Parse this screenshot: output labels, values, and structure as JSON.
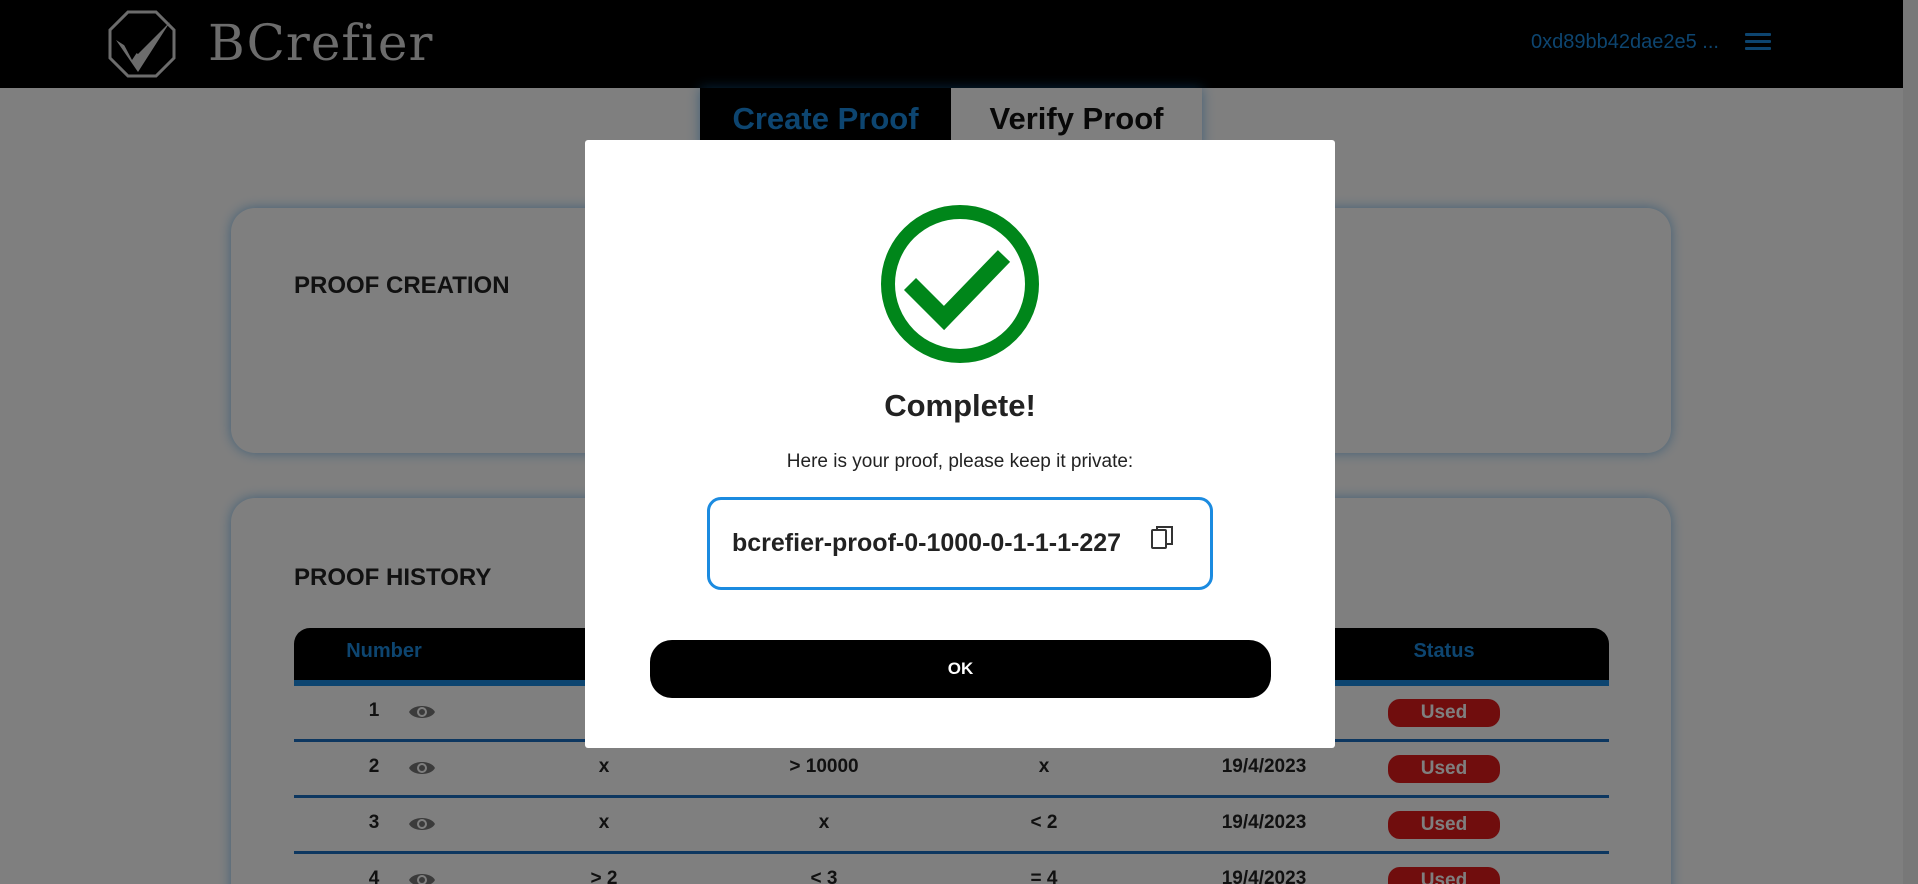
{
  "header": {
    "brand": "BCrefier",
    "wallet_address": "0xd89bb42dae2e5 ..."
  },
  "tabs": [
    {
      "label": "Create Proof",
      "active": true
    },
    {
      "label": "Verify Proof",
      "active": false
    }
  ],
  "creation": {
    "title": "PROOF CREATION"
  },
  "history": {
    "title": "PROOF HISTORY",
    "columns": [
      "Number",
      "",
      "",
      "",
      "",
      "Status"
    ],
    "rows": [
      {
        "number": "1",
        "c1": "",
        "c2": "",
        "c3": "",
        "date": "",
        "status": "Used"
      },
      {
        "number": "2",
        "c1": "x",
        "c2": "> 10000",
        "c3": "x",
        "date": "19/4/2023",
        "status": "Used"
      },
      {
        "number": "3",
        "c1": "x",
        "c2": "x",
        "c3": "< 2",
        "date": "19/4/2023",
        "status": "Used"
      },
      {
        "number": "4",
        "c1": "> 2",
        "c2": "< 3",
        "c3": "= 4",
        "date": "19/4/2023",
        "status": "Used"
      }
    ]
  },
  "modal": {
    "title": "Complete!",
    "message": "Here is your proof, please keep it private:",
    "proof": "bcrefier-proof-0-1000-0-1-1-1-227",
    "ok_label": "OK"
  },
  "colors": {
    "accent": "#1b8be0",
    "success": "#00861a",
    "status_used": "#e01a1a",
    "header_bg": "#000000"
  },
  "icons": {
    "logo": "checkmark-octagon-logo",
    "menu": "hamburger-menu-icon",
    "view": "eye-icon",
    "copy": "copy-icon",
    "success": "check-circle-icon"
  }
}
